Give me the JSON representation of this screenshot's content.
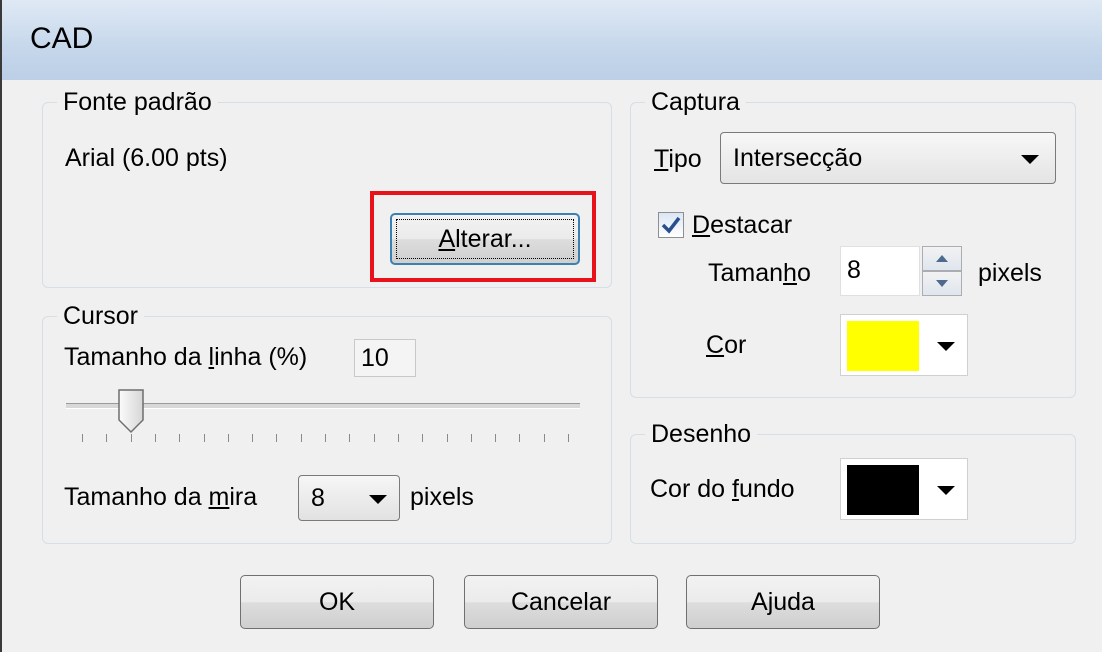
{
  "window": {
    "title": "CAD"
  },
  "fonte": {
    "legend": "Fonte padrão",
    "current_font": "Arial (6.00 pts)",
    "change_button": {
      "prefix": "",
      "mnemonic": "A",
      "rest": "lterar..."
    }
  },
  "cursor": {
    "legend": "Cursor",
    "line_size_label": {
      "before": "Tamanho da ",
      "mnemonic": "l",
      "after": "inha (%)"
    },
    "line_size_value": "10",
    "slider_percent": 10,
    "crosshair_label": {
      "before": "Tamanho da ",
      "mnemonic": "m",
      "after": "ira"
    },
    "crosshair_value": "8",
    "crosshair_unit": "pixels"
  },
  "captura": {
    "legend": "Captura",
    "tipo_label": {
      "before": "",
      "mnemonic": "T",
      "after": "ipo"
    },
    "tipo_value": "Intersecção",
    "destacar_label": {
      "before": "",
      "mnemonic": "D",
      "after": "estacar"
    },
    "destacar_checked": true,
    "tamanho_label": {
      "before": "Taman",
      "mnemonic": "h",
      "after": "o"
    },
    "tamanho_value": "8",
    "tamanho_unit": "pixels",
    "cor_label": {
      "before": "",
      "mnemonic": "C",
      "after": "or"
    },
    "cor_color": "#ffff00"
  },
  "desenho": {
    "legend": "Desenho",
    "fundo_label": {
      "before": "Cor do ",
      "mnemonic": "f",
      "after": "undo"
    },
    "fundo_color": "#000000"
  },
  "buttons": {
    "ok": "OK",
    "cancel": "Cancelar",
    "help": "Ajuda"
  }
}
